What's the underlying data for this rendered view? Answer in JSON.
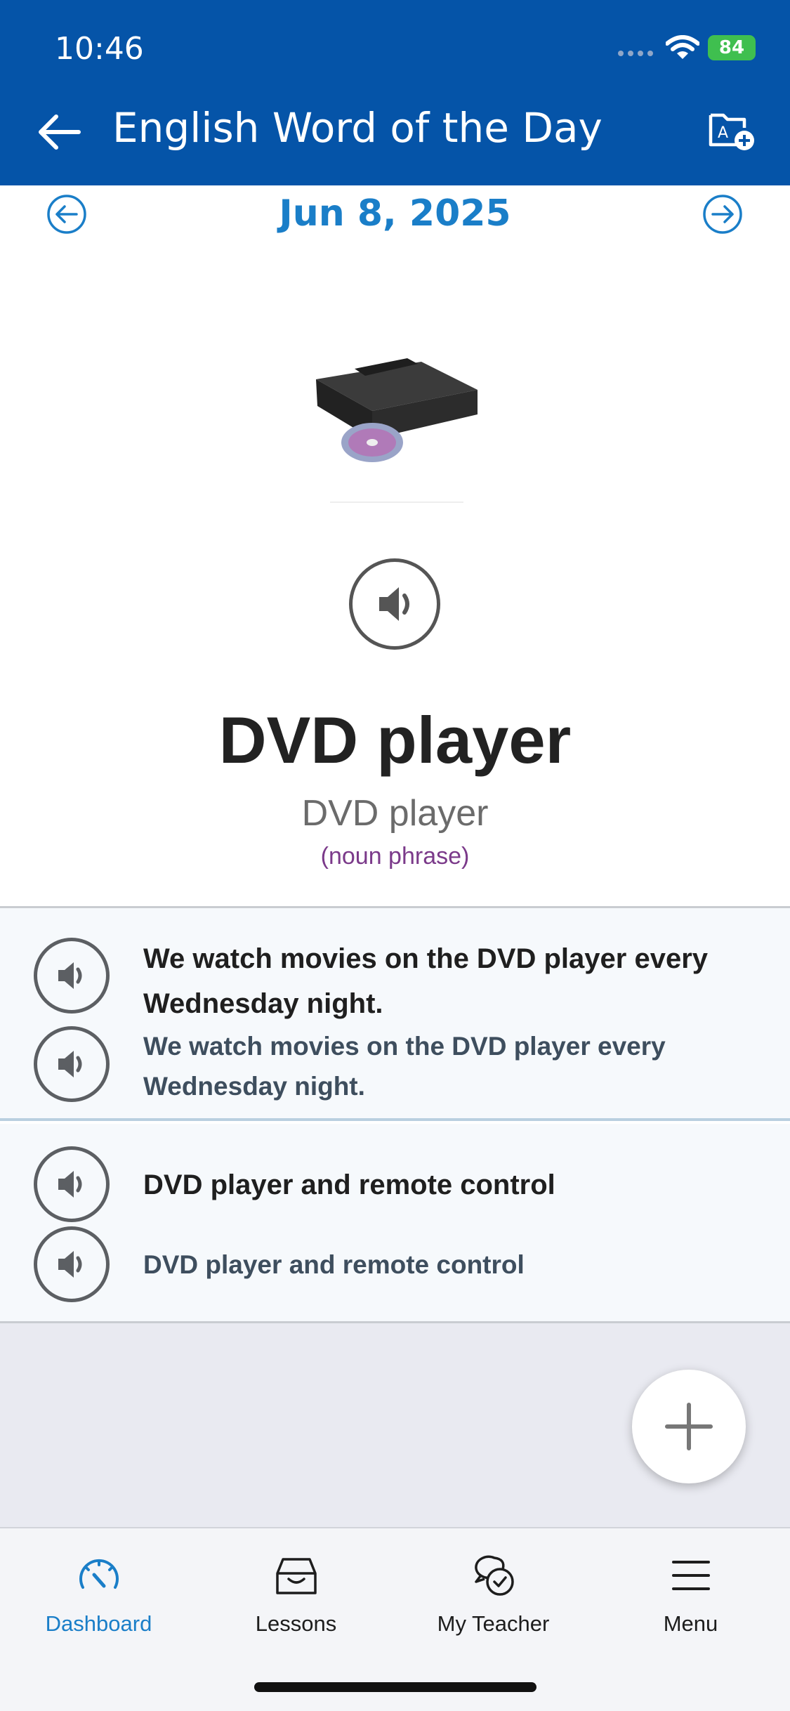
{
  "status_bar": {
    "time": "10:46",
    "battery": "84"
  },
  "header": {
    "title": "English Word of the Day",
    "back_icon": "arrow-left-icon",
    "action_icon": "add-to-folder-icon"
  },
  "date_nav": {
    "date": "Jun 8, 2025",
    "prev_icon": "circle-arrow-left-icon",
    "next_icon": "circle-arrow-right-icon"
  },
  "word": {
    "title": "DVD player",
    "subtitle": "DVD player",
    "part_of_speech": "(noun phrase)"
  },
  "sentences": [
    {
      "text": "We watch movies on the DVD player every Wednesday night.",
      "translation": "We watch movies on the DVD player every Wednesday night."
    },
    {
      "text": "DVD player and remote control",
      "translation": "DVD player and remote control"
    }
  ],
  "tabs": [
    {
      "label": "Dashboard",
      "icon": "speedometer-icon",
      "active": true
    },
    {
      "label": "Lessons",
      "icon": "inbox-tray-icon",
      "active": false
    },
    {
      "label": "My Teacher",
      "icon": "chat-bubbles-icon",
      "active": false
    },
    {
      "label": "Menu",
      "icon": "hamburger-menu-icon",
      "active": false
    }
  ],
  "colors": {
    "header_bg": "#0554a8",
    "accent": "#1a7ec8",
    "pos_color": "#7b3a8a",
    "battery": "#3fbf4f"
  }
}
